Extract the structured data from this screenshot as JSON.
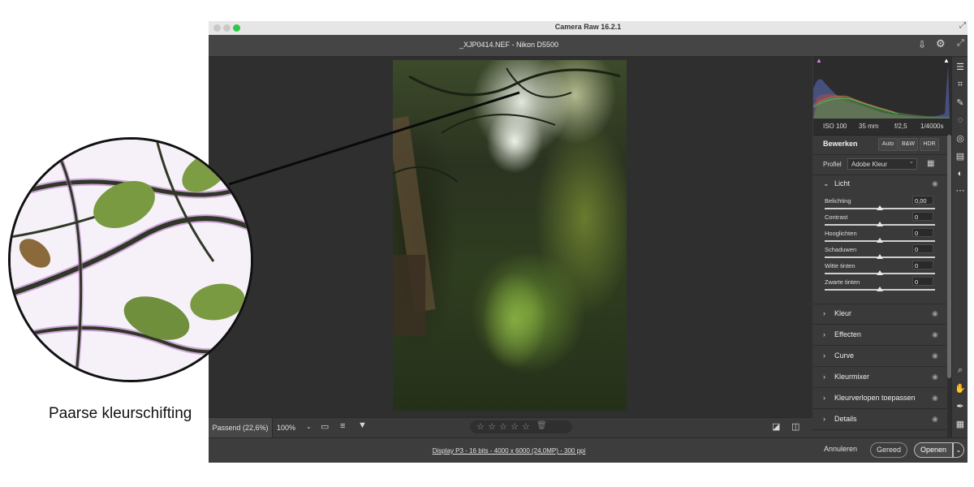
{
  "window": {
    "title": "Camera Raw 16.2.1",
    "file_title": "_XJP0414.NEF  -  Nikon D5500"
  },
  "image_toolbar": {
    "zoom_fit": "Passend (22,6%)",
    "zoom_level": "100%",
    "rating_stars": [
      "☆",
      "☆",
      "☆",
      "☆",
      "☆"
    ]
  },
  "status": {
    "info": "Display P3 - 16 bits - 4000 x 6000 (24,0MP) - 300 ppi",
    "cancel": "Annuleren",
    "done": "Gereed",
    "open": "Openen"
  },
  "exif": {
    "iso": "ISO 100",
    "focal": "35 mm",
    "aperture": "f/2,5",
    "shutter": "1/4000s"
  },
  "edit": {
    "title": "Bewerken",
    "auto": "Auto",
    "bw": "B&W",
    "hdr": "HDR",
    "profile_label": "Profiel",
    "profile_value": "Adobe Kleur"
  },
  "light": {
    "title": "Licht",
    "sliders": [
      {
        "label": "Belichting",
        "value": "0,00"
      },
      {
        "label": "Contrast",
        "value": "0"
      },
      {
        "label": "Hooglichten",
        "value": "0"
      },
      {
        "label": "Schaduwen",
        "value": "0"
      },
      {
        "label": "Witte tinten",
        "value": "0"
      },
      {
        "label": "Zwarte tinten",
        "value": "0"
      }
    ]
  },
  "sections": [
    "Kleur",
    "Effecten",
    "Curve",
    "Kleurmixer",
    "Kleurverlopen toepassen",
    "Details"
  ],
  "caption": "Paarse kleurschifting",
  "colors": {
    "traffic_green": "#33c748",
    "panel_bg": "#3a3a3a",
    "fringe_purple": "#b060c0"
  },
  "icons": {
    "save": "download-icon",
    "settings": "gear-icon",
    "expand": "expand-icon"
  }
}
